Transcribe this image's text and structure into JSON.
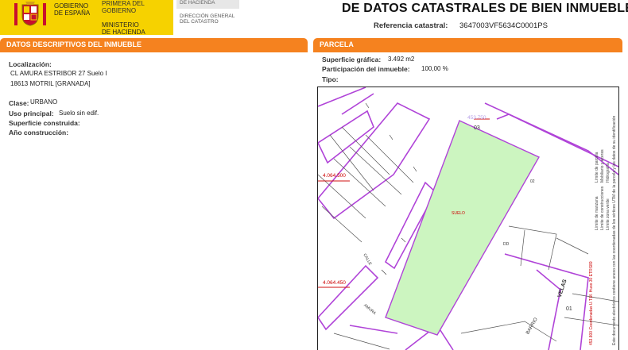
{
  "header": {
    "gov_lines": [
      "GOBIERNO",
      "DE ESPAÑA"
    ],
    "ministry_top_lines": [
      "PRIMERA DEL GOBIERNO"
    ],
    "ministry_lines": [
      "MINISTERIO",
      "DE HACIENDA"
    ],
    "dg_top": "DE HACIENDA",
    "dg_lines": [
      "DIRECCIÓN GENERAL",
      "DEL CATASTRO"
    ],
    "title": "DE DATOS CATASTRALES DE BIEN INMUEBLE",
    "ref_label": "Referencia catastral:",
    "ref_value": "3647003VF5634C0001PS",
    "colors": {
      "brand_yellow": "#f6d200",
      "accent_orange": "#f5821f",
      "parcel_fill": "#ccf5c0",
      "lines": "#b044d8"
    }
  },
  "left": {
    "section_title": "DATOS DESCRIPTIVOS DEL INMUEBLE",
    "localizacion_label": "Localización:",
    "localizacion_line1": "CL AMURA ESTRIBOR 27 Suelo I",
    "localizacion_line2": "18613 MOTRIL [GRANADA]",
    "clase_label": "Clase:",
    "clase_value": "URBANO",
    "uso_label": "Uso principal:",
    "uso_value": "Suelo sin edif.",
    "superficie_label": "Superficie construida:",
    "anio_label": "Año construcción:"
  },
  "right": {
    "section_title": "PARCELA",
    "sup_grafica_label": "Superficie gráfica:",
    "sup_grafica_value": "3.492 m2",
    "participacion_label": "Participación del inmueble:",
    "participacion_value": "100,00 %",
    "tipo_label": "Tipo:"
  },
  "map": {
    "parcel_label": "SUELO",
    "parcel_id": "03",
    "coord_top": "4.064.500",
    "coord_bottom": "4.064.450",
    "coord_right_top": "453.750",
    "adjacent_01": "01",
    "adjacent_02": "02",
    "adjacent_03": "03",
    "street_calle": "CALLE",
    "street_barrio": "BARRIO",
    "street_velas": "VELAS",
    "street_amura": "AMURA",
    "label_dd": "DD",
    "legend_lines": [
      "Límite de manzana",
      "Límite de parcela",
      "Límite de construcciones",
      "Mobiliario y aceras",
      "Límite zona verde",
      "Hidrografía",
      "Este documento electrónico contiene anexo con las coordenadas de los vértices UTM de la parcela y los datos de su identificación"
    ],
    "legend_coord": "453.800 Coordenadas U.T.M. Huso 30 ETRS89"
  }
}
